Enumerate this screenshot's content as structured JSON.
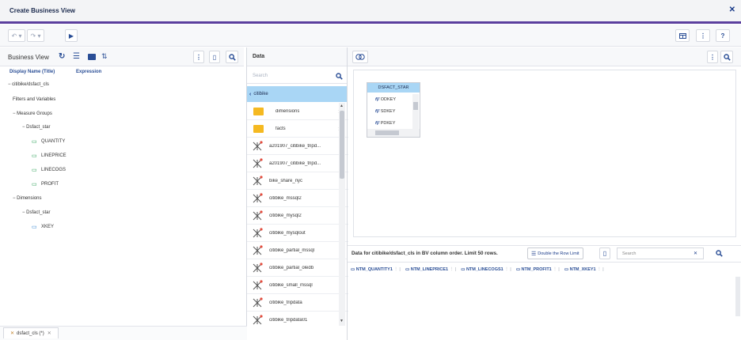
{
  "window": {
    "title": "Create Business View"
  },
  "toolbar": {
    "undo": "↶",
    "redo": "↷",
    "run": "▶",
    "help": "?"
  },
  "business_view": {
    "title": "Business View",
    "columns": {
      "display_name": "Display Name (Title)",
      "expression": "Expression"
    },
    "tree": [
      {
        "label": "− citibike/dsfact_cls"
      },
      {
        "label": "Filters and Variables"
      },
      {
        "label": "− Measure Groups"
      },
      {
        "label": "− Dsfact_star"
      },
      {
        "label": "QUANTITY"
      },
      {
        "label": "LINEPRICE"
      },
      {
        "label": "LINECOGS"
      },
      {
        "label": "PROFIT"
      },
      {
        "label": "− Dimensions"
      },
      {
        "label": "− Dsfact_star"
      },
      {
        "label": "XKEY"
      }
    ]
  },
  "data_panel": {
    "title": "Data",
    "search_placeholder": "Search",
    "breadcrumb": "citibike",
    "items": [
      {
        "label": "dimensions"
      },
      {
        "label": "facts"
      },
      {
        "label": "a201907_citibike_tripd..."
      },
      {
        "label": "a201907_citibike_tripd..."
      },
      {
        "label": "bike_share_nyc"
      },
      {
        "label": "citibike_mssql2"
      },
      {
        "label": "citibike_mysql2"
      },
      {
        "label": "citibike_mysqlout"
      },
      {
        "label": "citibike_partial_mssql"
      },
      {
        "label": "citibike_partial_oledb"
      },
      {
        "label": "citibike_small_mssql"
      },
      {
        "label": "citibike_tripdata"
      },
      {
        "label": "citibike_tripdata01"
      }
    ]
  },
  "diagram": {
    "table_title": "DSFACT_STAR",
    "fields": [
      "ODKEY",
      "SDKEY",
      "PDKEY"
    ]
  },
  "data_preview": {
    "description": "Data for citibike/dsfact_cls in BV column order. Limit 50 rows.",
    "double_row_button": "Double the Row Limit",
    "search_placeholder": "Search",
    "columns": [
      "NTM_QUANTITY1",
      "NTM_LINEPRICE1",
      "NTM_LINECOGS1",
      "NTM_PROFIT1",
      "NTM_XKEY1"
    ]
  },
  "bottom_tab": {
    "label": "dsfact_cls (*)"
  },
  "colors": {
    "accent": "#5b3f9e",
    "link": "#2a4e96",
    "measure": "#1c9a4b",
    "dimension": "#2a7fd0",
    "selected": "#a9d6f5"
  }
}
